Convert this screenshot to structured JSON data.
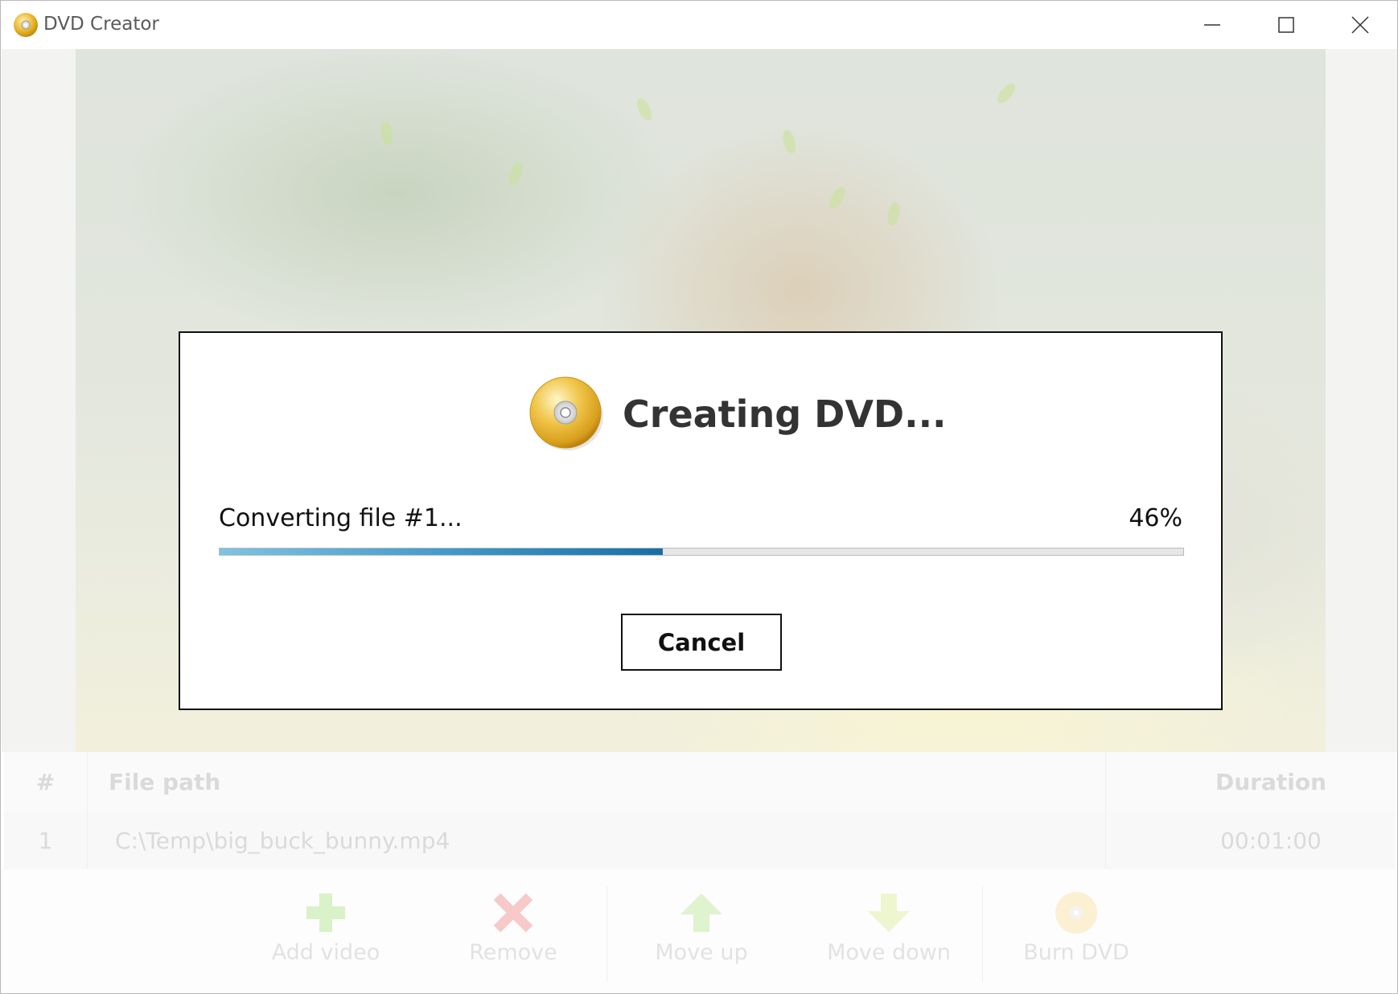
{
  "window": {
    "title": "DVD Creator",
    "icons": {
      "app": "dvd-disc-icon",
      "minimize": "minimize-icon",
      "maximize": "maximize-icon",
      "close": "close-icon"
    }
  },
  "dialog": {
    "title": "Creating DVD...",
    "icon": "dvd-disc-icon",
    "status": "Converting file #1...",
    "percent_label": "46%",
    "progress": 0.46,
    "cancel_label": "Cancel"
  },
  "table": {
    "headers": {
      "num": "#",
      "path": "File path",
      "duration": "Duration"
    },
    "rows": [
      {
        "num": "1",
        "path": "C:\\Temp\\big_buck_bunny.mp4",
        "duration": "00:01:00"
      }
    ]
  },
  "toolbar": {
    "add": {
      "label": "Add video",
      "icon": "plus-icon"
    },
    "remove": {
      "label": "Remove",
      "icon": "x-icon"
    },
    "move_up": {
      "label": "Move up",
      "icon": "arrow-up-icon"
    },
    "move_down": {
      "label": "Move down",
      "icon": "arrow-down-icon"
    },
    "burn": {
      "label": "Burn DVD",
      "icon": "dvd-disc-icon"
    }
  },
  "colors": {
    "progress_start": "#7fc3e2",
    "progress_end": "#1a6ea6",
    "disc_gold": "#e8b52a"
  }
}
